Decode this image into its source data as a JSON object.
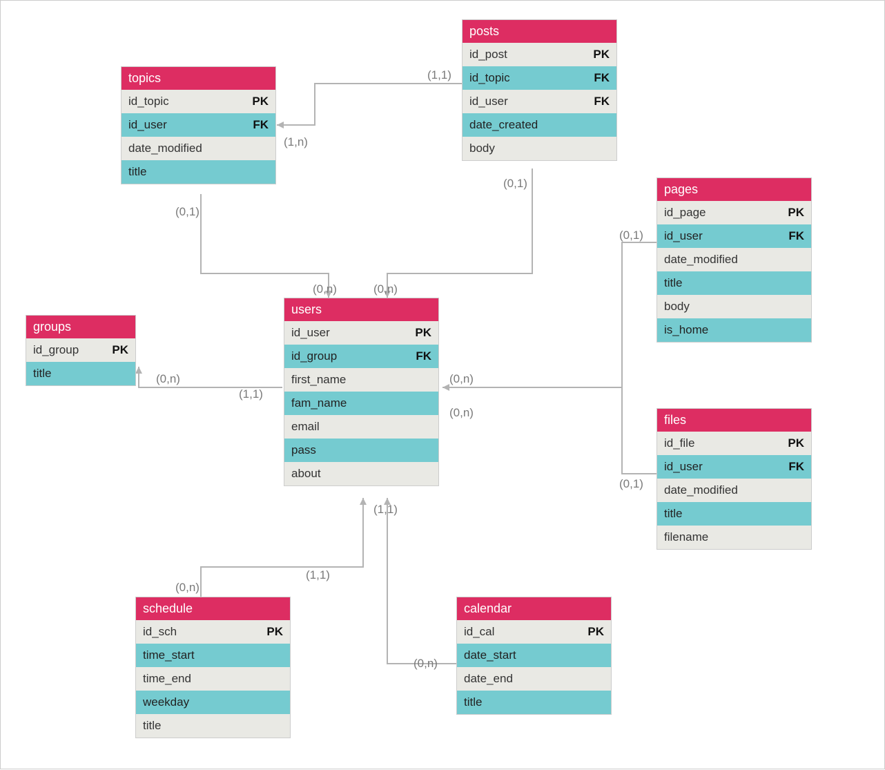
{
  "colors": {
    "header": "#dd2d62",
    "rowOdd": "#e9e9e4",
    "rowEven": "#75cbd0",
    "connector": "#b3b3b3",
    "cardinality": "#7a7a7a"
  },
  "entities": {
    "topics": {
      "title": "topics",
      "fields": [
        {
          "name": "id_topic",
          "key": "PK"
        },
        {
          "name": "id_user",
          "key": "FK"
        },
        {
          "name": "date_modified",
          "key": ""
        },
        {
          "name": "title",
          "key": ""
        }
      ]
    },
    "posts": {
      "title": "posts",
      "fields": [
        {
          "name": "id_post",
          "key": "PK"
        },
        {
          "name": "id_topic",
          "key": "FK"
        },
        {
          "name": "id_user",
          "key": "FK"
        },
        {
          "name": "date_created",
          "key": ""
        },
        {
          "name": "body",
          "key": ""
        }
      ]
    },
    "pages": {
      "title": "pages",
      "fields": [
        {
          "name": "id_page",
          "key": "PK"
        },
        {
          "name": "id_user",
          "key": "FK"
        },
        {
          "name": "date_modified",
          "key": ""
        },
        {
          "name": "title",
          "key": ""
        },
        {
          "name": "body",
          "key": ""
        },
        {
          "name": "is_home",
          "key": ""
        }
      ]
    },
    "groups": {
      "title": "groups",
      "fields": [
        {
          "name": "id_group",
          "key": "PK"
        },
        {
          "name": "title",
          "key": ""
        }
      ]
    },
    "users": {
      "title": "users",
      "fields": [
        {
          "name": "id_user",
          "key": "PK"
        },
        {
          "name": "id_group",
          "key": "FK"
        },
        {
          "name": "first_name",
          "key": ""
        },
        {
          "name": "fam_name",
          "key": ""
        },
        {
          "name": "email",
          "key": ""
        },
        {
          "name": "pass",
          "key": ""
        },
        {
          "name": "about",
          "key": ""
        }
      ]
    },
    "files": {
      "title": "files",
      "fields": [
        {
          "name": "id_file",
          "key": "PK"
        },
        {
          "name": "id_user",
          "key": "FK"
        },
        {
          "name": "date_modified",
          "key": ""
        },
        {
          "name": "title",
          "key": ""
        },
        {
          "name": "filename",
          "key": ""
        }
      ]
    },
    "schedule": {
      "title": "schedule",
      "fields": [
        {
          "name": "id_sch",
          "key": "PK"
        },
        {
          "name": "time_start",
          "key": ""
        },
        {
          "name": "time_end",
          "key": ""
        },
        {
          "name": "weekday",
          "key": ""
        },
        {
          "name": "title",
          "key": ""
        }
      ]
    },
    "calendar": {
      "title": "calendar",
      "fields": [
        {
          "name": "id_cal",
          "key": "PK"
        },
        {
          "name": "date_start",
          "key": ""
        },
        {
          "name": "date_end",
          "key": ""
        },
        {
          "name": "title",
          "key": ""
        }
      ]
    }
  },
  "relations": [
    {
      "from": "posts",
      "to": "topics",
      "card_from": "(1,1)",
      "card_to": "(1,n)"
    },
    {
      "from": "topics",
      "to": "users",
      "card_from": "(0,1)",
      "card_to": "(0,n)"
    },
    {
      "from": "posts",
      "to": "users",
      "card_from": "(0,1)",
      "card_to": "(0,n)"
    },
    {
      "from": "users",
      "to": "groups",
      "card_from": "(1,1)",
      "card_to": "(0,n)"
    },
    {
      "from": "pages",
      "to": "users",
      "card_from": "(0,1)",
      "card_to": "(0,n)"
    },
    {
      "from": "files",
      "to": "users",
      "card_from": "(0,1)",
      "card_to": "(0,n)"
    },
    {
      "from": "schedule",
      "to": "users",
      "card_from": "(0,n)",
      "card_to": "(1,1)"
    },
    {
      "from": "calendar",
      "to": "users",
      "card_from": "(0,n)",
      "card_to": "(1,1)"
    }
  ],
  "cardinality_labels": {
    "posts_topics_from": "(1,1)",
    "posts_topics_to": "(1,n)",
    "topics_users_from": "(0,1)",
    "topics_users_to": "(0,n)",
    "posts_users_from": "(0,1)",
    "posts_users_to": "(0,n)",
    "users_groups_from": "(1,1)",
    "users_groups_to": "(0,n)",
    "pages_users_from": "(0,1)",
    "pages_users_to": "(0,n)",
    "files_users_from": "(0,1)",
    "schedule_users_from": "(0,n)",
    "schedule_users_to": "(1,1)",
    "calendar_users_from": "(0,n)",
    "calendar_users_to": "(1,1)"
  }
}
